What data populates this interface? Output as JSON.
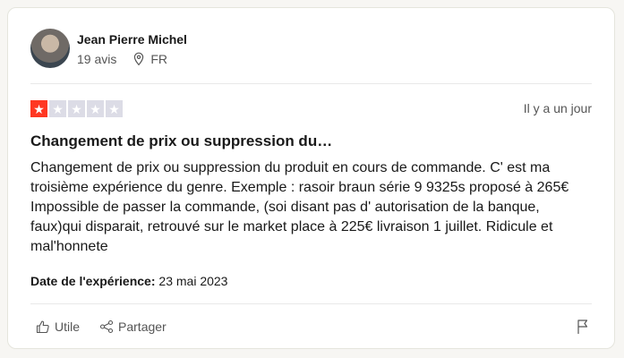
{
  "author": {
    "name": "Jean Pierre Michel",
    "reviews": "19 avis",
    "country": "FR"
  },
  "review": {
    "rating": 1,
    "rating_max": 5,
    "date_relative": "Il y a un jour",
    "title": "Changement de prix ou suppression du…",
    "text": "Changement de prix ou suppression du produit en cours de commande. C' est ma troisième expérience du genre. Exemple : rasoir braun série 9 9325s proposé à 265€ Impossible de passer la commande, (soi disant pas d' autorisation de la banque, faux)qui disparait, retrouvé sur le market place à 225€ livraison 1 juillet. Ridicule et mal'honnete",
    "experience_label": "Date de l'expérience:",
    "experience_date": "23 mai 2023"
  },
  "actions": {
    "useful": "Utile",
    "share": "Partager"
  },
  "colors": {
    "star_active": "#ff3722",
    "star_inactive": "#dcdce6"
  },
  "icons": {
    "location": "pin-icon",
    "useful": "thumbs-up-icon",
    "share": "share-icon",
    "report": "flag-icon"
  }
}
